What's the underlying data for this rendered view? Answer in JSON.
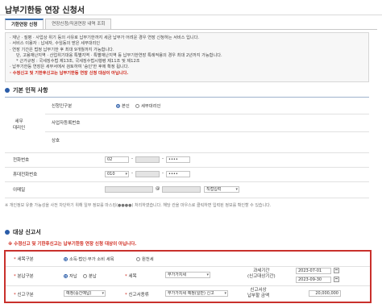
{
  "header": {
    "title": "납부기한등 연장 신청서"
  },
  "tabs": [
    {
      "label": "기한연장 신청",
      "active": true
    },
    {
      "label": "연장신청/직권연장 내역 조회",
      "active": false
    }
  ],
  "notice": {
    "lines": [
      "· 재난 · 질병 · 사업상 위기 등의 사유로 납부기한까지 세금 납부가 어려운 경우 연장 신청하는 서비스 입니다.",
      "· 서비스 이용자 : 납세자, 수임동의 받은 세무대리인",
      "· 연장 기간은 법정 납부기한 후 최대 9개월까지 가능합니다.",
      "  단, 고용재난지역 · 산업위기대응 특별지역 · 특별재난지역 등 납부기한연장 특례적용의 경우 최대 2년까지 가능합니다.",
      "  * 근거규정 : 국세징수법 제13조, 국세징수법시행령 제11조 및 제12조",
      "· 납부기한등 연장은 세무서에서 검토하여 '승인'한 후에 확정 됩니다.",
      "· 수정신고 및 기한후신고는 납부기한등 연장 신청 대상이 아닙니다."
    ],
    "warning_index": 6
  },
  "basic": {
    "section_title": "기본 인적 사항",
    "proxy_label": "세무\n대리인",
    "applicant_type_label": "신청인구분",
    "applicant_options": [
      {
        "label": "본인",
        "checked": true
      },
      {
        "label": "세무대리인",
        "checked": false
      }
    ],
    "bizno_label": "사업자등록번호",
    "trade_label": "상호",
    "phone_label": "전화번호",
    "phone_prefix": "02",
    "phone_last": "••••",
    "mobile_label": "휴대전화번호",
    "mobile_prefix": "010",
    "mobile_last": "••••",
    "email_label": "이메일",
    "email_at": "@",
    "email_domain": "직접입력",
    "privacy_note": "※ 개인정보 유출 가능성을 사전 차단하기 위해 일부 정보를 마스킹(●●●●) 처리하였습니다. 해당 칸을 마우스로 클릭하면 입력된 정보를 확인할 수 있습니다."
  },
  "target": {
    "section_title": "대상 신고서",
    "warning": "※ 수정신고 및 기한후신고는 납부기한등 연장 신청 대상이 아닙니다.",
    "tax_type_label": "세목구분",
    "tax_type_options": [
      {
        "label": "소득·법인·부가 소비 세목",
        "checked": true
      },
      {
        "label": "원천세",
        "checked": false
      }
    ],
    "split_label": "분납구분",
    "split_options": [
      {
        "label": "자납",
        "checked": true
      },
      {
        "label": "분납",
        "checked": false
      }
    ],
    "item_label": "세목",
    "item_value": "부가가치세",
    "period_label": "과세기간\n(신고대상기간)",
    "period_from": "2023-07-01",
    "period_to": "2023-09-30",
    "report_type_label": "신고구분",
    "report_type_value": "예정(중간예납)",
    "form_type_label": "신고서종류",
    "form_type_value": "부가가치세 예정(일반) 신고",
    "amount_label": "신고서상\n납부할 금액",
    "amount_value": "20,000,000"
  }
}
